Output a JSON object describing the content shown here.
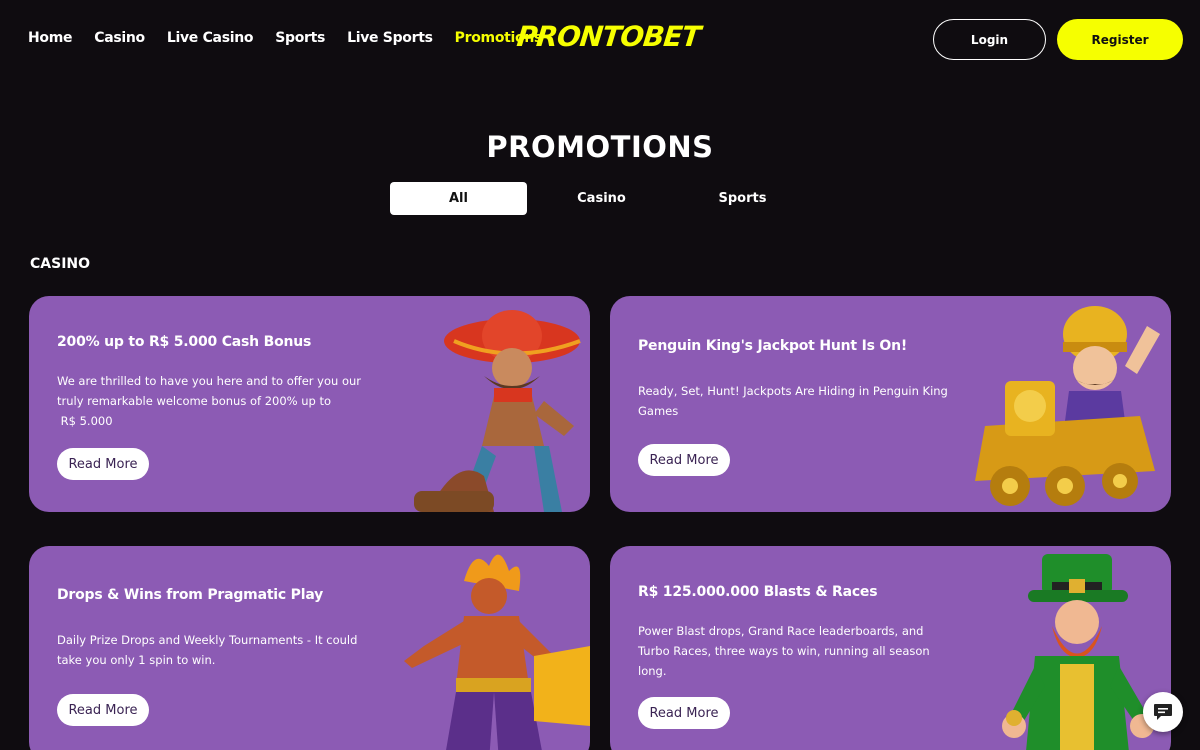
{
  "nav": {
    "items": [
      "Home",
      "Casino",
      "Live Casino",
      "Sports",
      "Live Sports",
      "Promotions"
    ],
    "active": "Promotions"
  },
  "brand": {
    "logo_text": "PRONTOBET"
  },
  "auth": {
    "login_label": "Login",
    "register_label": "Register"
  },
  "page": {
    "title": "PROMOTIONS"
  },
  "tabs": [
    {
      "label": "All",
      "active": true
    },
    {
      "label": "Casino",
      "active": false
    },
    {
      "label": "Sports",
      "active": false
    }
  ],
  "section": {
    "label": "CASINO"
  },
  "promos": [
    {
      "title": "200% up to R$ 5.000 Cash Bonus",
      "desc_lines": [
        "We are thrilled to have you here and to offer you our",
        "truly remarkable welcome bonus of 200% up to",
        " R$ 5.000"
      ],
      "button": "Read More",
      "art": "cowboy-character-icon"
    },
    {
      "title": "Penguin King's Jackpot Hunt Is On!",
      "desc_lines": [
        "Ready, Set, Hunt! Jackpots Are Hiding in Penguin King",
        "Games"
      ],
      "button": "Read More",
      "art": "golden-train-character-icon"
    },
    {
      "title": "Drops & Wins from Pragmatic Play",
      "desc_lines": [
        "Daily Prize Drops and Weekly Tournaments - It could",
        "take you only 1 spin to win."
      ],
      "button": "Read More",
      "art": "fire-warrior-character-icon"
    },
    {
      "title": "R$ 125.000.000 Blasts & Races",
      "desc_lines": [
        "Power Blast drops, Grand Race leaderboards, and",
        "Turbo Races, three ways to win, running all season",
        "long."
      ],
      "button": "Read More",
      "art": "leprechaun-character-icon"
    }
  ],
  "colors": {
    "background": "#0f0c10",
    "accent": "#f6ff00",
    "card": "#8c5bb4"
  },
  "chat": {
    "icon": "chat-icon"
  }
}
